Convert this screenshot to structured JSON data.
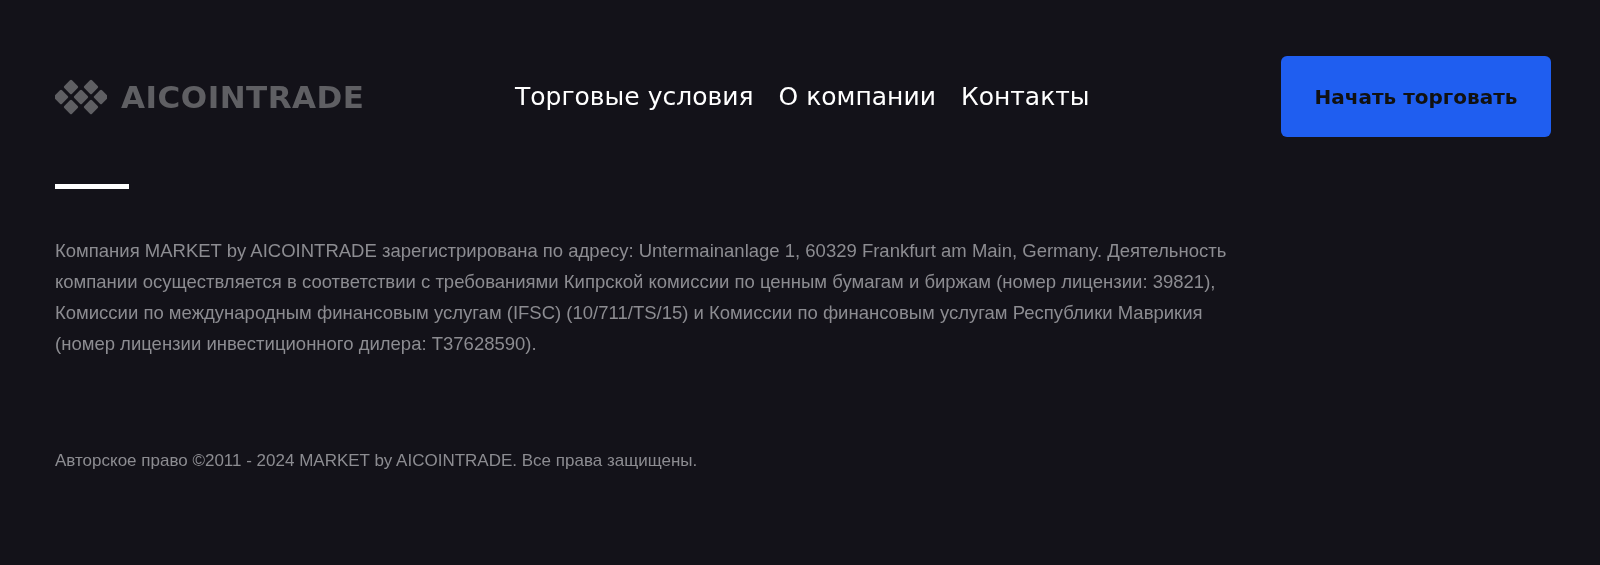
{
  "header": {
    "logo": "AICOINTRADE",
    "nav": [
      "Торговые условия",
      "О компании",
      "Контакты"
    ],
    "cta_button": "Начать торговать"
  },
  "legal_text": "Компания MARKET by AICOINTRADE зарегистрирована по адресу: Untermainanlage 1, 60329 Frankfurt am Main, Germany. Деятельность компании осуществляется в соответствии с требованиями Кипрской комиссии по ценным бумагам и биржам (номер лицензии: 39821), Комиссии по международным финансовым услугам (IFSC) (10/711/TS/15) и Комиссии по финансовым услугам Республики Маврикия (номер лицензии инвестиционного дилера: T37628590).",
  "copyright": "Авторское право ©2011 - 2024 MARKET by AICOINTRADE. Все права защищены."
}
